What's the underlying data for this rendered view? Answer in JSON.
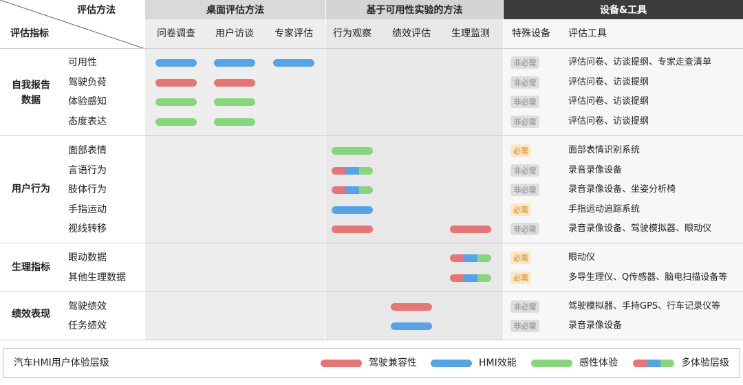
{
  "colors": {
    "red": "#e97474",
    "blue": "#55a4e8",
    "green": "#86d67b",
    "desk_bg": "#eeeeee",
    "usab_bg": "#e8e8e8",
    "dark_hdr": "#3c3c3c",
    "required_text": "#d8871a",
    "required_bg": "#fbe7c3",
    "optional_bg": "#dddddd"
  },
  "header": {
    "corner_method": "评估方法",
    "corner_metric": "评估指标",
    "group_desk": "桌面评估方法",
    "group_usability": "基于可用性实验的方法",
    "group_tools": "设备&工具",
    "col_survey": "问卷调查",
    "col_interview": "用户访谈",
    "col_expert": "专家评估",
    "col_observe": "行为观察",
    "col_perf": "绩效评估",
    "col_physio": "生理监测",
    "col_device": "特殊设备",
    "col_tools": "评估工具"
  },
  "categories": {
    "self_report": "自我报告\n数据",
    "user_behavior": "用户行为",
    "physio": "生理指标",
    "perf": "绩效表现"
  },
  "rows": [
    {
      "label": "可用性",
      "device": "非必需",
      "required": false,
      "tools": "评估问卷、访谈提纲、专家走查清单",
      "bars": [
        {
          "col": "survey",
          "type": "blue"
        },
        {
          "col": "interview",
          "type": "blue"
        },
        {
          "col": "expert",
          "type": "blue"
        }
      ]
    },
    {
      "label": "驾驶负荷",
      "device": "非必需",
      "required": false,
      "tools": "评估问卷、访谈提纲",
      "bars": [
        {
          "col": "survey",
          "type": "red"
        },
        {
          "col": "interview",
          "type": "red"
        }
      ]
    },
    {
      "label": "体验感知",
      "device": "非必需",
      "required": false,
      "tools": "评估问卷、访谈提纲",
      "bars": [
        {
          "col": "survey",
          "type": "green"
        },
        {
          "col": "interview",
          "type": "green"
        }
      ]
    },
    {
      "label": "态度表达",
      "device": "非必需",
      "required": false,
      "tools": "评估问卷、访谈提纲",
      "bars": [
        {
          "col": "survey",
          "type": "green"
        },
        {
          "col": "interview",
          "type": "green"
        }
      ]
    },
    {
      "label": "面部表情",
      "device": "必需",
      "required": true,
      "tools": "面部表情识别系统",
      "bars": [
        {
          "col": "observe",
          "type": "green"
        }
      ]
    },
    {
      "label": "言语行为",
      "device": "非必需",
      "required": false,
      "tools": "录音录像设备",
      "bars": [
        {
          "col": "observe",
          "type": "multi"
        }
      ]
    },
    {
      "label": "肢体行为",
      "device": "非必需",
      "required": false,
      "tools": "录音录像设备、坐姿分析椅",
      "bars": [
        {
          "col": "observe",
          "type": "multi"
        }
      ]
    },
    {
      "label": "手指运动",
      "device": "必需",
      "required": true,
      "tools": "手指运动追踪系统",
      "bars": [
        {
          "col": "observe",
          "type": "blue"
        }
      ]
    },
    {
      "label": "视线转移",
      "device": "非必需",
      "required": false,
      "tools": "录音录像设备、驾驶模拟器、眼动仪",
      "bars": [
        {
          "col": "observe",
          "type": "red"
        },
        {
          "col": "physio",
          "type": "red"
        }
      ]
    },
    {
      "label": "眼动数据",
      "device": "必需",
      "required": true,
      "tools": "眼动仪",
      "bars": [
        {
          "col": "physio",
          "type": "multi"
        }
      ]
    },
    {
      "label": "其他生理数据",
      "device": "必需",
      "required": true,
      "tools": "多导生理仪、Q传感器、脑电扫描设备等",
      "bars": [
        {
          "col": "physio",
          "type": "multi"
        }
      ]
    },
    {
      "label": "驾驶绩效",
      "device": "非必需",
      "required": false,
      "tools": "驾驶模拟器、手持GPS、行车记录仪等",
      "bars": [
        {
          "col": "perf",
          "type": "red"
        }
      ]
    },
    {
      "label": "任务绩效",
      "device": "非必需",
      "required": false,
      "tools": "录音录像设备",
      "bars": [
        {
          "col": "perf",
          "type": "blue"
        }
      ]
    }
  ],
  "legend": {
    "title": "汽车HMI用户体验层级",
    "red_label": "驾驶兼容性",
    "blue_label": "HMI效能",
    "green_label": "感性体验",
    "multi_label": "多体验层级"
  }
}
